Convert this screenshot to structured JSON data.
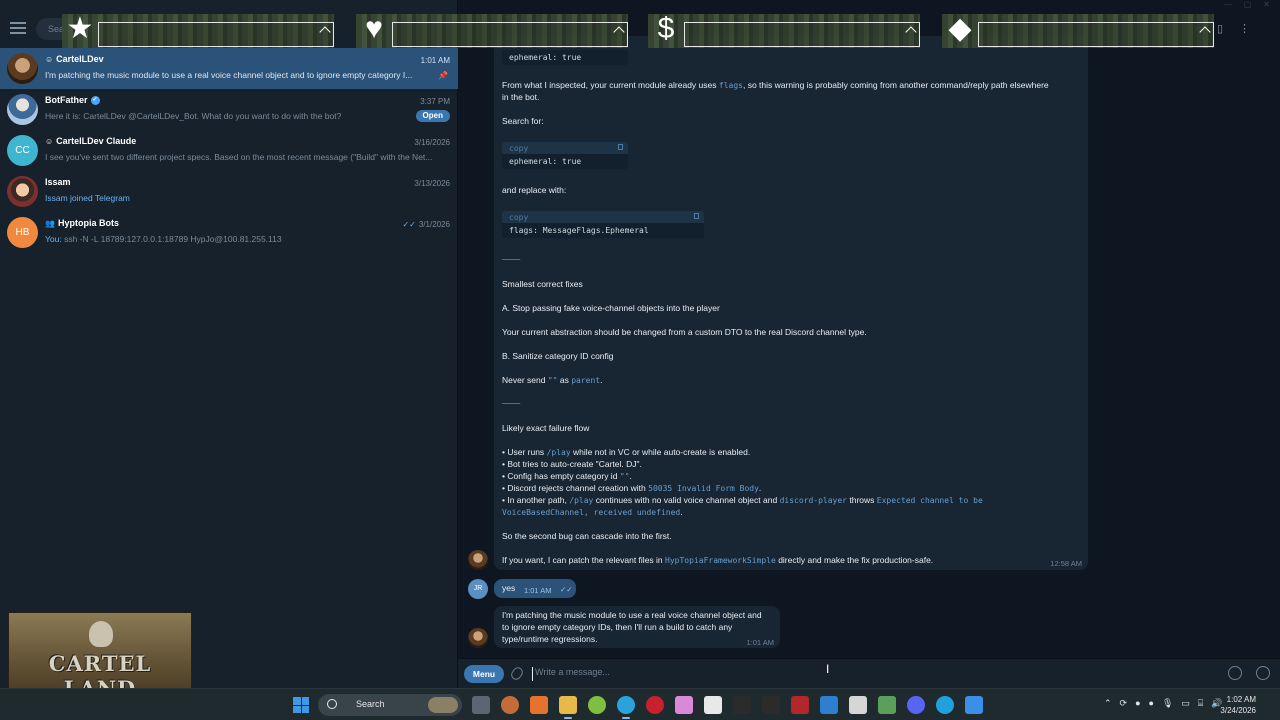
{
  "sidebar": {
    "search_placeholder": "Sea",
    "chats": [
      {
        "name": "CartelLDev",
        "time": "1:01 AM",
        "preview": "I'm patching the music module to use a real voice channel object and to ignore empty category I...",
        "active": true
      },
      {
        "name": "BotFather",
        "time": "3:37 PM",
        "preview": "Here it is: CartelLDev @CartelLDev_Bot. What do you want to do with the bot?",
        "badge": "Open"
      },
      {
        "name": "CartelLDev Claude",
        "time": "3/16/2026",
        "preview": "I see you've sent two different project specs. Based on the most recent message (\"Build\" with the Net...",
        "initials": "CC"
      },
      {
        "name": "Issam",
        "time": "3/13/2026",
        "preview": "Issam joined Telegram"
      },
      {
        "name": "Hyptopia Bots",
        "time": "3/1/2026",
        "preview_prefix": "You:",
        "preview": "ssh -N -L 18789:127.0.0.1:18789 HypJo@100.81.255.113",
        "initials": "HB"
      }
    ],
    "logo_text": "CARTEL LAND"
  },
  "overlay": {
    "icons": [
      "star-icon",
      "heart-icon",
      "dollar-icon",
      "diamond-icon"
    ],
    "glyphs": [
      "★",
      "♥",
      "$",
      "◆"
    ]
  },
  "conversation": {
    "code_top": "ephemeral: true",
    "p1": "From what I inspected, your current module already uses",
    "p1_code": "flags",
    "p1_tail": ", so this warning is probably coming from another command/reply path elsewhere",
    "p1_line2": "in the bot.",
    "search_for": "Search for:",
    "copy_label": "copy",
    "code_search": "ephemeral: true",
    "replace_with": "and replace with:",
    "code_replace": "flags: MessageFlags.Ephemeral",
    "divider": "_____",
    "fixes_title": "Smallest correct fixes",
    "fix_a": "A. Stop passing fake voice-channel objects into the player",
    "fix_a_desc": "Your current abstraction should be changed from a custom DTO to the real Discord channel type.",
    "fix_b": "B. Sanitize category ID config",
    "never_send": "Never send",
    "never_send_code": "\"\"",
    "never_send_as": "as",
    "never_send_code2": "parent",
    "flow_title": "Likely exact failure flow",
    "b1_pre": "• User runs",
    "b1_code": "/play",
    "b1_post": "while not in VC or while auto-create is enabled.",
    "b2": "• Bot tries to auto-create \"Cartel. DJ\".",
    "b3_pre": "• Config has empty category id",
    "b3_code": "\"\"",
    "b4_pre": "• Discord rejects channel creation with",
    "b4_code": "50035 Invalid Form Body",
    "b5_pre": "• In another path,",
    "b5_code": "/play",
    "b5_mid": "continues with no valid voice channel object and",
    "b5_code2": "discord-player",
    "b5_throws": "throws",
    "b5_code3": "Expected channel to be",
    "b5_code4": "VoiceBasedChannel, received undefined",
    "cascade": "So the second bug can cascade into the first.",
    "patch_pre": "If you want, I can patch the relevant files in",
    "patch_code": "HypTopiaFrameworkSimple",
    "patch_post": "directly and make the fix production-safe.",
    "bubble_time": "12:58 AM",
    "yes_text": "yes",
    "yes_time": "1:01 AM",
    "user_initials": "JR",
    "reply_l1": "I'm patching the music module to use a real voice channel object and",
    "reply_l2": "to ignore empty category IDs, then I'll run a build to catch any",
    "reply_l3": "type/runtime regressions.",
    "reply_time": "1:01 AM"
  },
  "composer": {
    "menu_label": "Menu",
    "placeholder": "Write a message..."
  },
  "taskbar": {
    "search_label": "Search",
    "time": "1:02 AM",
    "date": "3/24/2026"
  }
}
